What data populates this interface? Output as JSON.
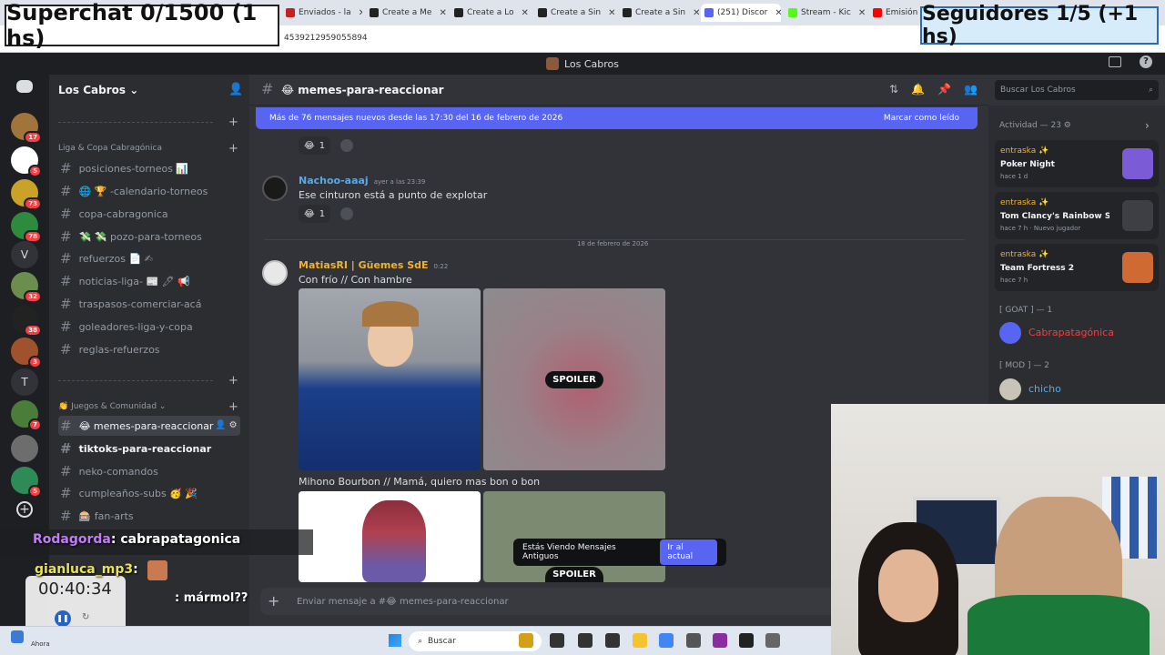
{
  "overlay": {
    "superchat": "Superchat 0/1500 (1 hs)",
    "seguidores": "Seguidores 1/5 (+1 hs)"
  },
  "browser": {
    "tabs": [
      {
        "label": "Enviados - la",
        "favicon_color": "#c5221f"
      },
      {
        "label": "Create a Me",
        "favicon_color": "#222222"
      },
      {
        "label": "Create a Lo",
        "favicon_color": "#222222"
      },
      {
        "label": "Create a Sin",
        "favicon_color": "#222222"
      },
      {
        "label": "Create a Sin",
        "favicon_color": "#222222"
      },
      {
        "label": "(251) Discor",
        "favicon_color": "#5865f2"
      },
      {
        "label": "Stream - Kic",
        "favicon_color": "#53fc18"
      },
      {
        "label": "Emisión en",
        "favicon_color": "#ff0000"
      }
    ],
    "url_fragment": "4539212959055894"
  },
  "discord": {
    "window_title": "Los Cabros",
    "server_name": "Los Cabros",
    "guilds": [
      {
        "badge": "17",
        "color": "#a0743a"
      },
      {
        "badge": "5",
        "color": "#ffffff"
      },
      {
        "badge": "73",
        "color": "#c9a227"
      },
      {
        "badge": "78",
        "color": "#2d8a3e"
      },
      {
        "letter": "V",
        "color": "#313338"
      },
      {
        "badge": "32",
        "color": "#6b8e4e"
      },
      {
        "badge": "38",
        "color": "#222222"
      },
      {
        "badge": "3",
        "color": "#a0522d"
      },
      {
        "letter": "T",
        "color": "#313338"
      },
      {
        "badge": "7",
        "color": "#4a7c3a"
      },
      {
        "badge": "",
        "color": "#6d6d6d"
      },
      {
        "badge": "5",
        "color": "#2e8b57"
      }
    ],
    "categories": {
      "liga": "Liga & Copa Cabragónica",
      "juegos": "Juegos & Comunidad"
    },
    "channels": [
      {
        "name": "posiciones-torneos 📊",
        "state": "normal"
      },
      {
        "name": "🌐 🏆 -calendario-torneos",
        "state": "normal"
      },
      {
        "name": "copa-cabragonica",
        "state": "normal"
      },
      {
        "name": "💸 💸 pozo-para-torneos",
        "state": "normal"
      },
      {
        "name": "refuerzos 📄 ✍",
        "state": "normal"
      },
      {
        "name": "noticias-liga- 📰 🖊 📢",
        "state": "normal"
      },
      {
        "name": "traspasos-comerciar-acá",
        "state": "normal"
      },
      {
        "name": "goleadores-liga-y-copa",
        "state": "normal"
      },
      {
        "name": "reglas-refuerzos",
        "state": "normal"
      },
      {
        "name": "😂 memes-para-reaccionar",
        "state": "active"
      },
      {
        "name": "tiktoks-para-reaccionar",
        "state": "unread"
      },
      {
        "name": "neko-comandos",
        "state": "normal"
      },
      {
        "name": "cumpleaños-subs 🥳 🎉",
        "state": "normal"
      },
      {
        "name": "🎰 fan-arts",
        "state": "normal"
      }
    ],
    "header": {
      "channel": "😂 memes-para-reaccionar",
      "search_placeholder": "Buscar Los Cabros"
    },
    "banner": {
      "text": "Más de 76 mensajes nuevos desde las 17:30 del 16 de febrero de 2026",
      "action": "Marcar como leído"
    },
    "messages": [
      {
        "reaction_count": "1"
      },
      {
        "author": "Nachoo-aaaj",
        "time": "ayer a las 23:39",
        "text": "Ese cinturon está a punto de explotar",
        "reaction_count": "1",
        "color": "#5aa9e6"
      },
      {
        "author": "MatiasRI | Güemes SdE",
        "time": "0:22",
        "text": "Con frío // Con hambre",
        "color": "#f0b232"
      },
      {
        "text": "Mihono Bourbon // Mamá, quiero mas bon o bon"
      }
    ],
    "date_separator": "18 de febrero de 2026",
    "spoiler_label": "SPOILER",
    "old_messages": {
      "text": "Estás Viendo Mensajes Antiguos",
      "button": "Ir al actual"
    },
    "input_placeholder": "Enviar mensaje a #😂 memes-para-reaccionar",
    "members": {
      "activity_header": "Actividad — 23",
      "activities": [
        {
          "user": "entraska ✨",
          "game": "Poker Night",
          "meta": "hace 1 d",
          "color": "#7b5cd6"
        },
        {
          "user": "entraska ✨",
          "game": "Tom Clancy's Rainbow Six ...",
          "meta": "hace 7 h  ·  Nuevo jugador",
          "color": "#3d3f45"
        },
        {
          "user": "entraska ✨",
          "game": "Team Fortress 2",
          "meta": "hace 7 h",
          "color": "#cf6a32"
        }
      ],
      "goat_header": "[ GOAT ] — 1",
      "goat_member": "Cabrapatagónica",
      "mod_header": "[ MOD ] — 2",
      "mod_member": "chicho"
    }
  },
  "stream": {
    "chat_user1": "Rodagorda",
    "chat_msg1": ": cabrapatagonica",
    "chat_user2": "gianluca_mp3",
    "chat_msg2": ":",
    "chat_blurred": ": mármol??",
    "timer": "00:40:34"
  },
  "taskbar": {
    "search": "Buscar",
    "clock_label": "Ahora"
  }
}
